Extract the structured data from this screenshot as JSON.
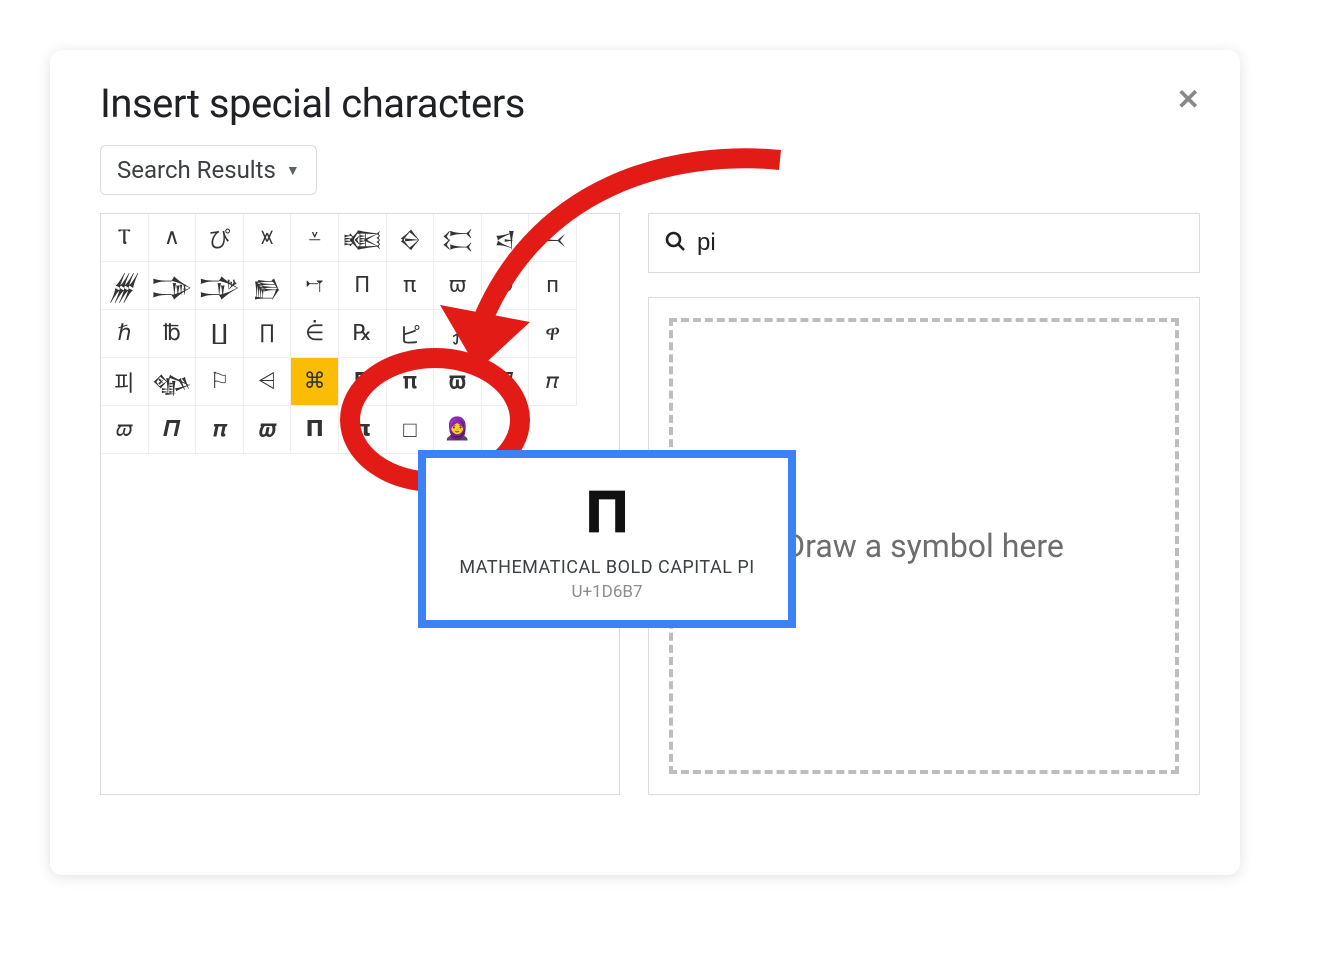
{
  "dialog": {
    "title": "Insert special characters",
    "dropdown_label": "Search Results",
    "search_value": "pi",
    "draw_prompt": "Draw a symbol here",
    "selected_index": 34,
    "chars": [
      "Ⲧ",
      "∧",
      "ぴ",
      "⩙",
      "⩡",
      "𒀩",
      "𒀪",
      "𒀫",
      "𒁀",
      "𒁁",
      "𒁂",
      "𒁊",
      "𒁋",
      "𒁖",
      "𐎎",
      "Π",
      "π",
      "ϖ",
      "Ⅾ",
      "п",
      "ℏ",
      "℔",
      "∐",
      "∏",
      "⋵",
      "℞",
      "ピ",
      "⨏",
      "▶",
      "ዋ",
      "피",
      "𒀲",
      "⚐",
      "⩤",
      "⌘",
      "𝚷",
      "𝛑",
      "𝛡",
      "𝛱",
      "𝜋",
      "𝜛",
      "𝜫",
      "𝝅",
      "𝝕",
      "𝝥",
      "𝝿",
      "□",
      "🧕"
    ]
  },
  "tooltip": {
    "glyph": "𝚷",
    "name": "MATHEMATICAL BOLD CAPITAL PI",
    "code": "U+1D6B7"
  }
}
